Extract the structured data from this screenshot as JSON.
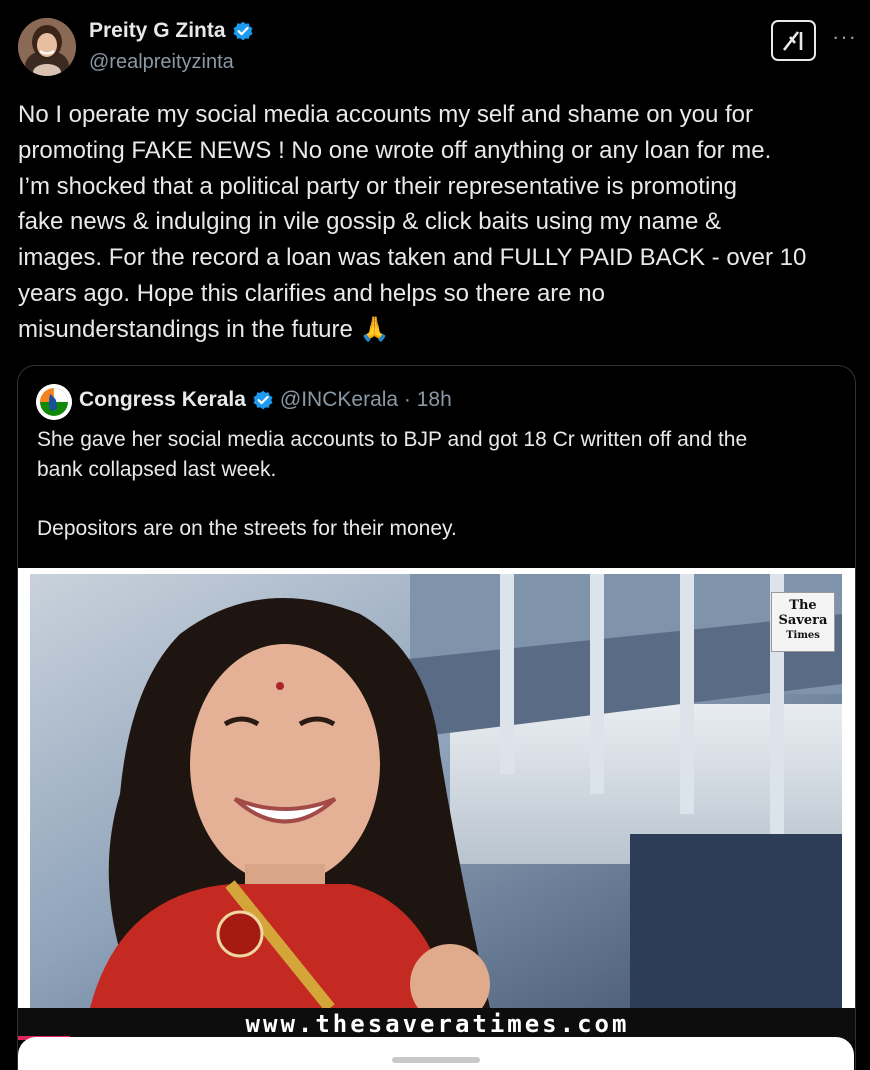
{
  "author": {
    "name": "Preity G Zinta",
    "handle": "@realpreityzinta",
    "verified": true
  },
  "actions": {
    "grok_icon": "grok-icon",
    "more_label": "···"
  },
  "tweet": {
    "text": "No I operate my social media accounts my self and shame on you for\npromoting FAKE NEWS ! No one wrote off anything or any loan for me.\nI’m shocked that a political party or their representative is promoting\nfake news & indulging in vile gossip & click baits using my name &\nimages. For the record a loan was taken and FULLY PAID BACK - over 10\nyears ago. Hope this clarifies and helps so there are no\nmisunderstandings in the future 🙏"
  },
  "quoted": {
    "name": "Congress Kerala",
    "handle_time": "@INCKerala · 18h",
    "verified": true,
    "text": "She gave her social media accounts to BJP and got 18 Cr written off and the\nbank collapsed last week.\n\nDepositors are on the streets for their money.",
    "media": {
      "watermark_line1": "The",
      "watermark_line2": "Savera",
      "watermark_line3": "Times",
      "url_text": "www.thesaveratimes.com"
    }
  },
  "colors": {
    "background": "#000000",
    "text": "#e7e9ea",
    "secondary": "#8b98a5",
    "verified_blue": "#1d9bf0",
    "border": "#2f3336"
  }
}
